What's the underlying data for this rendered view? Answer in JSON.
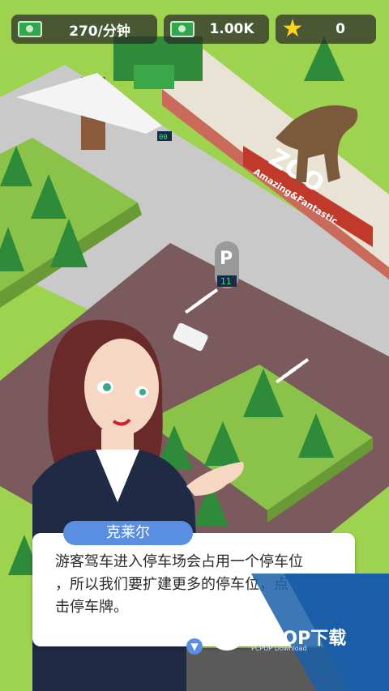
{
  "hud": {
    "income": "270/分钟",
    "money": "1.00K",
    "stars": "0"
  },
  "scene": {
    "zoo_sign": "ZOO",
    "zoo_subtitle": "Amazing&Fantastic",
    "gate_counter": "00",
    "parking_sign": "P",
    "parking_count": "11"
  },
  "dialog": {
    "speaker": "克莱尔",
    "lines": [
      "游客驾车进入停车场会占用一个停车位",
      "，所以我们要扩建更多的停车位，点",
      "击停车牌。"
    ]
  },
  "watermark": {
    "text": "PCPOP下载",
    "sub": "PCPOP Download"
  }
}
